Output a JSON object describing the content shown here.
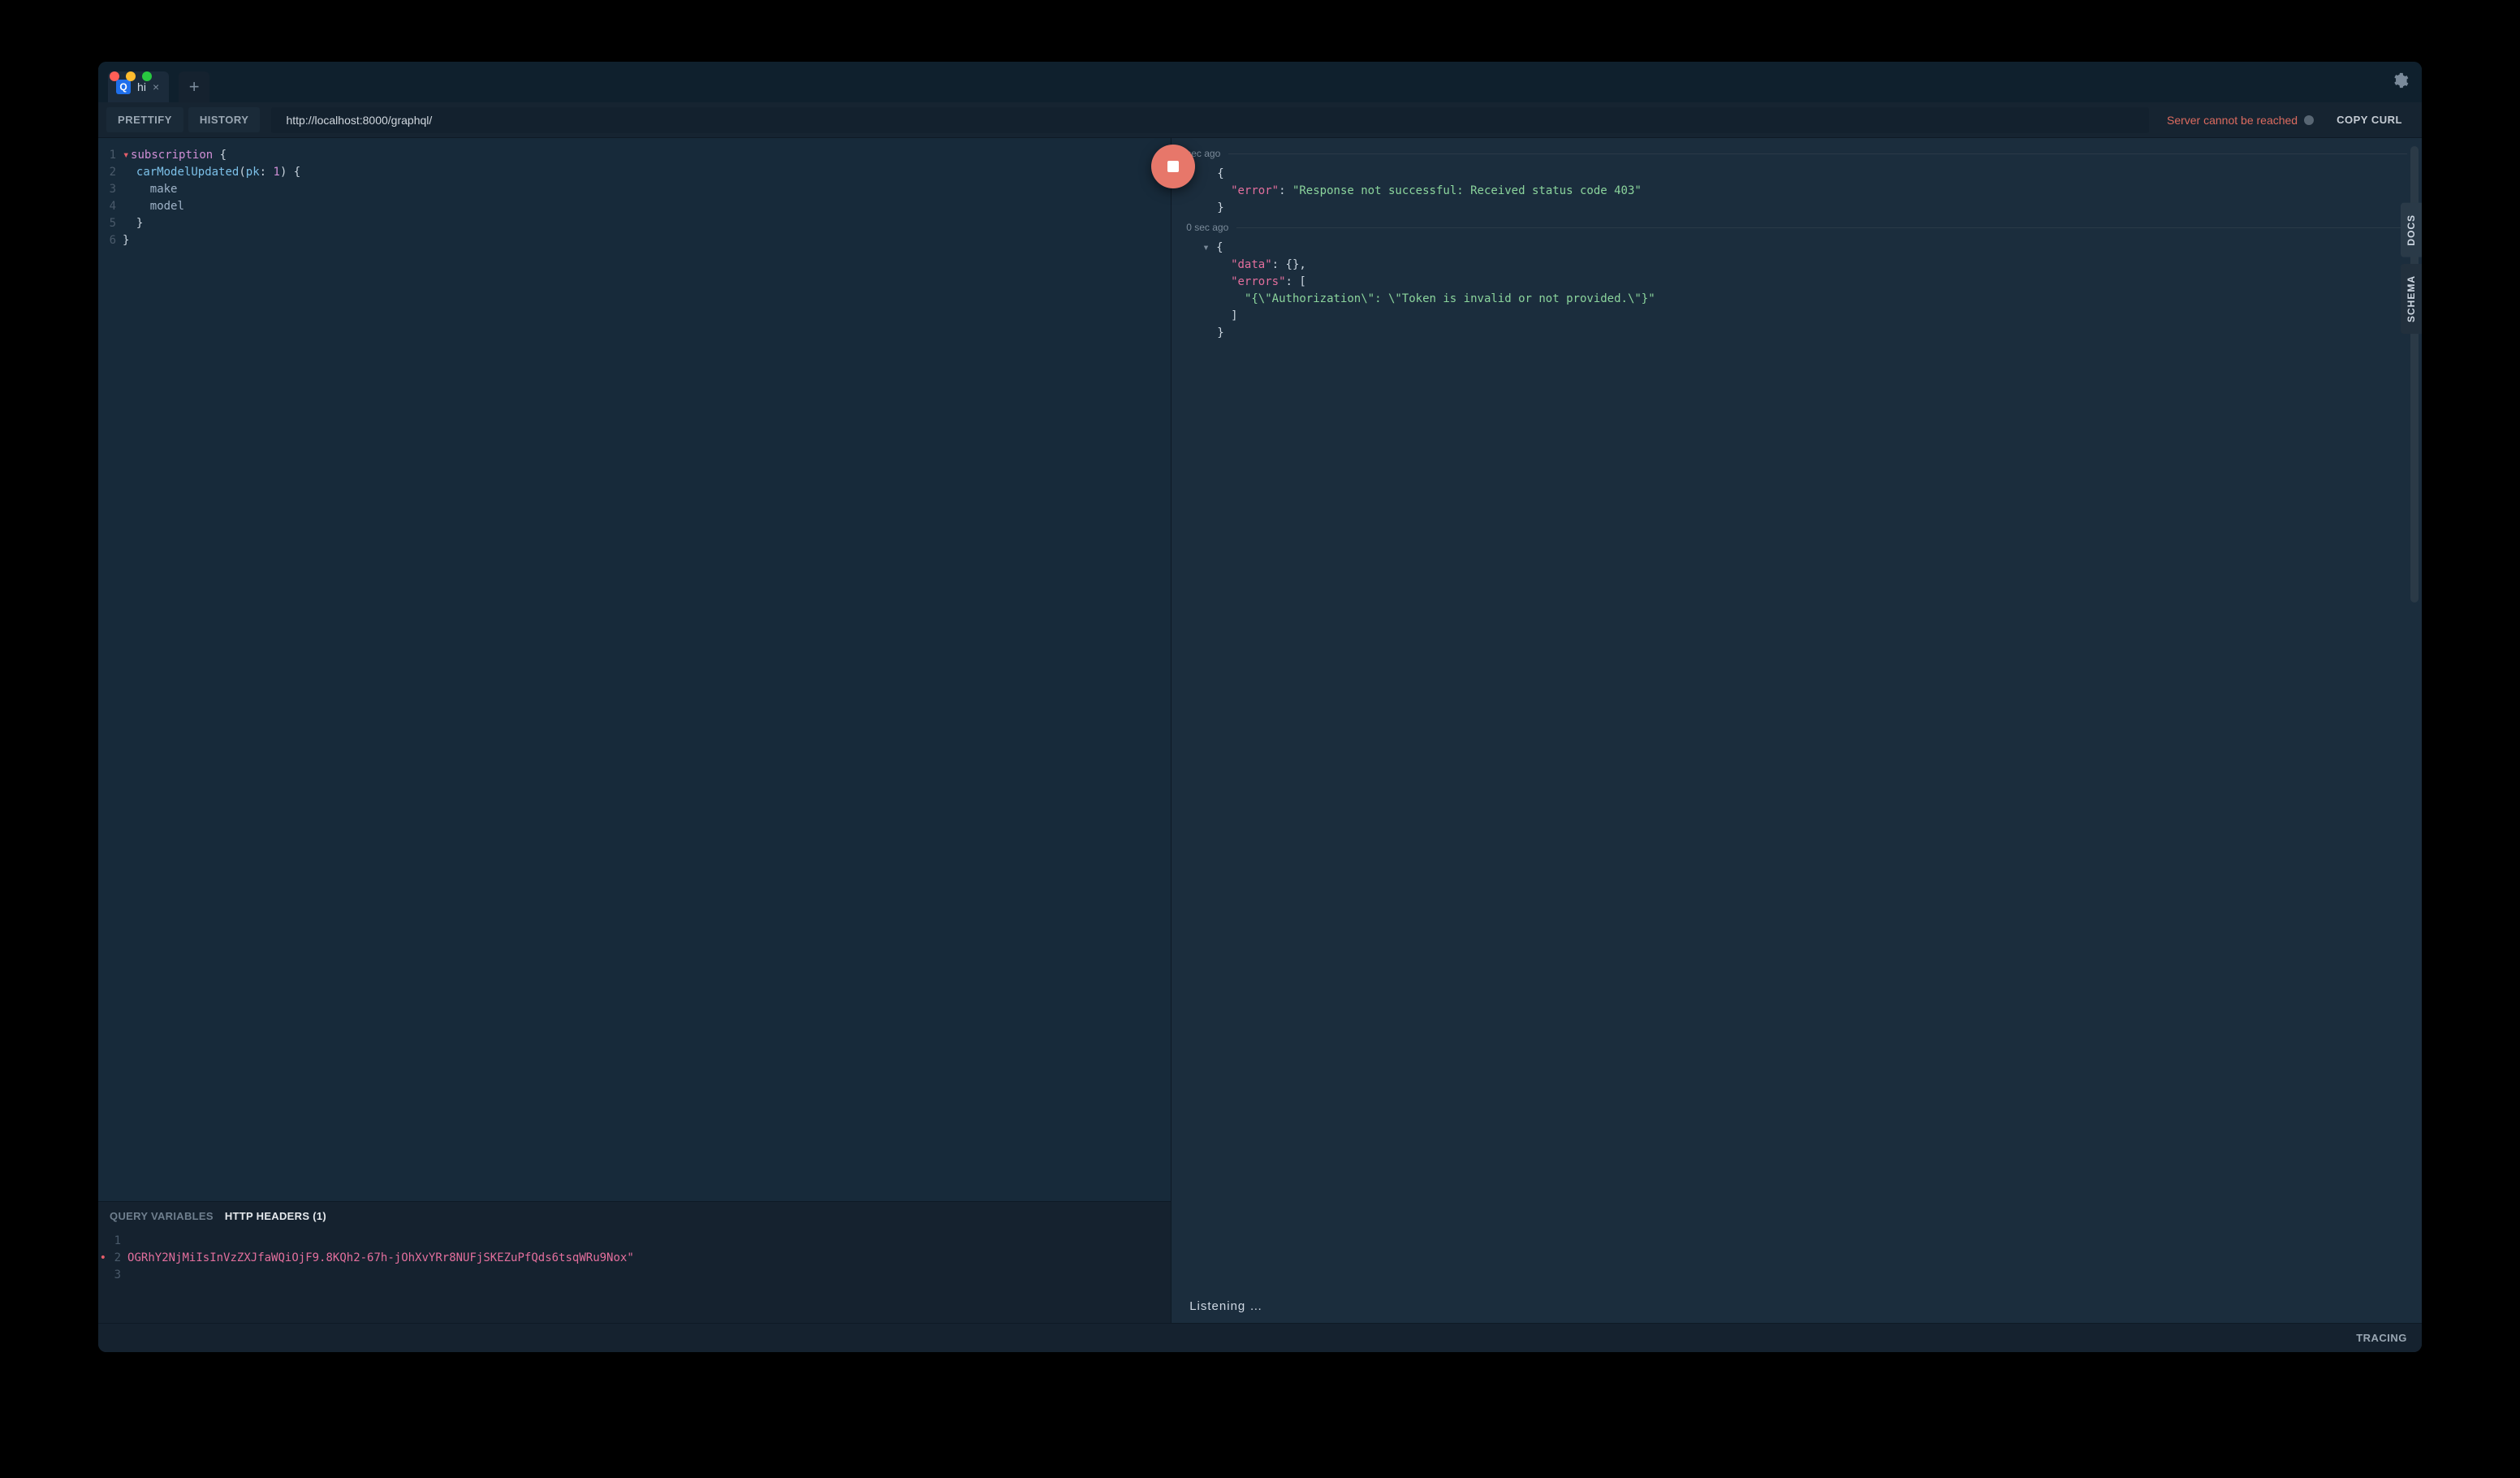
{
  "window": {
    "tab_icon_letter": "Q",
    "tab_title": "hi",
    "tab_close_glyph": "×",
    "new_tab_glyph": "+"
  },
  "toolbar": {
    "prettify": "PRETTIFY",
    "history": "HISTORY",
    "url": "http://localhost:8000/graphql/",
    "server_status": "Server cannot be reached",
    "copy_curl": "COPY CURL"
  },
  "editor": {
    "lines": [
      "1",
      "2",
      "3",
      "4",
      "5",
      "6"
    ],
    "code": {
      "l1_fold": "▾",
      "l1_kw": "subscription",
      "l1_rest": " {",
      "l2_indent": "  ",
      "l2_fn": "carModelUpdated",
      "l2_open": "(",
      "l2_arg": "pk",
      "l2_colon": ": ",
      "l2_num": "1",
      "l2_close": ") {",
      "l3": "    make",
      "l4": "    model",
      "l5": "  }",
      "l6": "}"
    }
  },
  "vars": {
    "tab_qv": "QUERY VARIABLES",
    "tab_hh": "HTTP HEADERS (1)",
    "gutter": [
      "1",
      "2",
      "3"
    ],
    "line1": "",
    "bullet": "•",
    "line2": "OGRhY2NjMiIsInVzZXJfaWQiOjF9.8KQh2-67h-jOhXvYRr8NUFjSKEZuPfQds6tsqWRu9Nox\"",
    "line3": ""
  },
  "results": {
    "blocks": [
      {
        "timestamp": " sec ago",
        "rows": [
          {
            "pre": "",
            "text": "{",
            "cls": "p"
          },
          {
            "pre": "  ",
            "key": "\"error\"",
            "colon": ": ",
            "val": "\"Response not successful: Received status code 403\""
          },
          {
            "pre": "",
            "text": "}",
            "cls": "p"
          }
        ]
      },
      {
        "timestamp": "0 sec ago",
        "caret": "▾ ",
        "rows": [
          {
            "pre": "",
            "text": "{",
            "cls": "p"
          },
          {
            "pre": "  ",
            "key": "\"data\"",
            "colon": ": ",
            "plain": "{},"
          },
          {
            "pre": "  ",
            "key": "\"errors\"",
            "colon": ": ",
            "plain": "["
          },
          {
            "pre": "    ",
            "val": "\"{\\\"Authorization\\\": \\\"Token is invalid or not provided.\\\"}\""
          },
          {
            "pre": "  ",
            "plain": "]"
          },
          {
            "pre": "",
            "text": "}",
            "cls": "p"
          }
        ]
      }
    ],
    "listening": "Listening …"
  },
  "side": {
    "docs": "DOCS",
    "schema": "SCHEMA"
  },
  "footer": {
    "tracing": "TRACING"
  }
}
